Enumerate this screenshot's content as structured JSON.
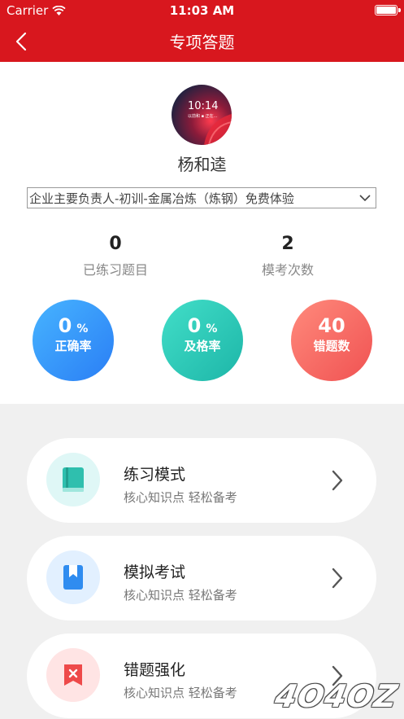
{
  "status_bar": {
    "carrier": "Carrier",
    "time": "11:03 AM"
  },
  "nav": {
    "title": "专项答题"
  },
  "profile": {
    "avatar_time": "10:14",
    "avatar_sub": "以前和 ▪ 正在…",
    "name": "杨和逵",
    "course": "企业主要负责人-初训-金属冶炼（炼钢）免费体验"
  },
  "stats": [
    {
      "value": "0",
      "label": "已练习题目"
    },
    {
      "value": "2",
      "label": "模考次数"
    }
  ],
  "circles": [
    {
      "value": "0",
      "unit": "%",
      "label": "正确率"
    },
    {
      "value": "0",
      "unit": "%",
      "label": "及格率"
    },
    {
      "value": "40",
      "unit": "",
      "label": "错题数"
    }
  ],
  "modes": [
    {
      "title": "练习模式",
      "subtitle": "核心知识点 轻松备考",
      "icon": "book-icon"
    },
    {
      "title": "模拟考试",
      "subtitle": "核心知识点 轻松备考",
      "icon": "bookmark-icon"
    },
    {
      "title": "错题强化",
      "subtitle": "核心知识点 轻松备考",
      "icon": "error-flag-icon"
    }
  ],
  "colors": {
    "header": "#d8171e",
    "blue": "#2a7ef5",
    "teal": "#1db6a8",
    "red": "#f05252"
  }
}
